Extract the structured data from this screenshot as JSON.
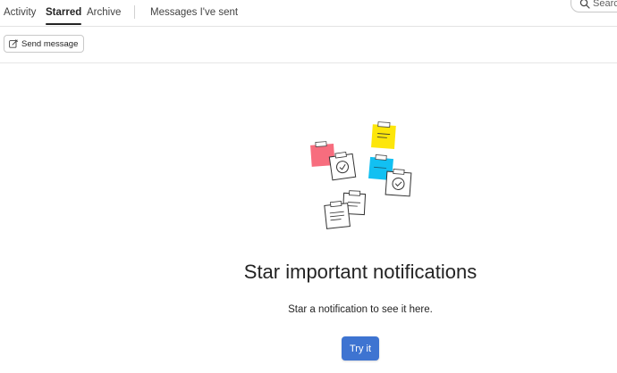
{
  "tabs": [
    {
      "label": "Activity",
      "active": false
    },
    {
      "label": "Starred",
      "active": true
    },
    {
      "label": "Archive",
      "active": false
    },
    {
      "label": "Messages I've sent",
      "active": false
    }
  ],
  "search": {
    "placeholder": "Search",
    "icon": "search-icon"
  },
  "toolbar": {
    "send_label": "Send message",
    "send_icon": "compose-icon"
  },
  "empty_state": {
    "title": "Star important notifications",
    "subtitle": "Star a notification to see it here.",
    "button_label": "Try it",
    "illustration": "sticky-notes-illustration"
  },
  "colors": {
    "accent": "#3e74d1",
    "note_pink": "#f76d7e",
    "note_yellow": "#fde60a",
    "note_cyan": "#12c0f2"
  }
}
